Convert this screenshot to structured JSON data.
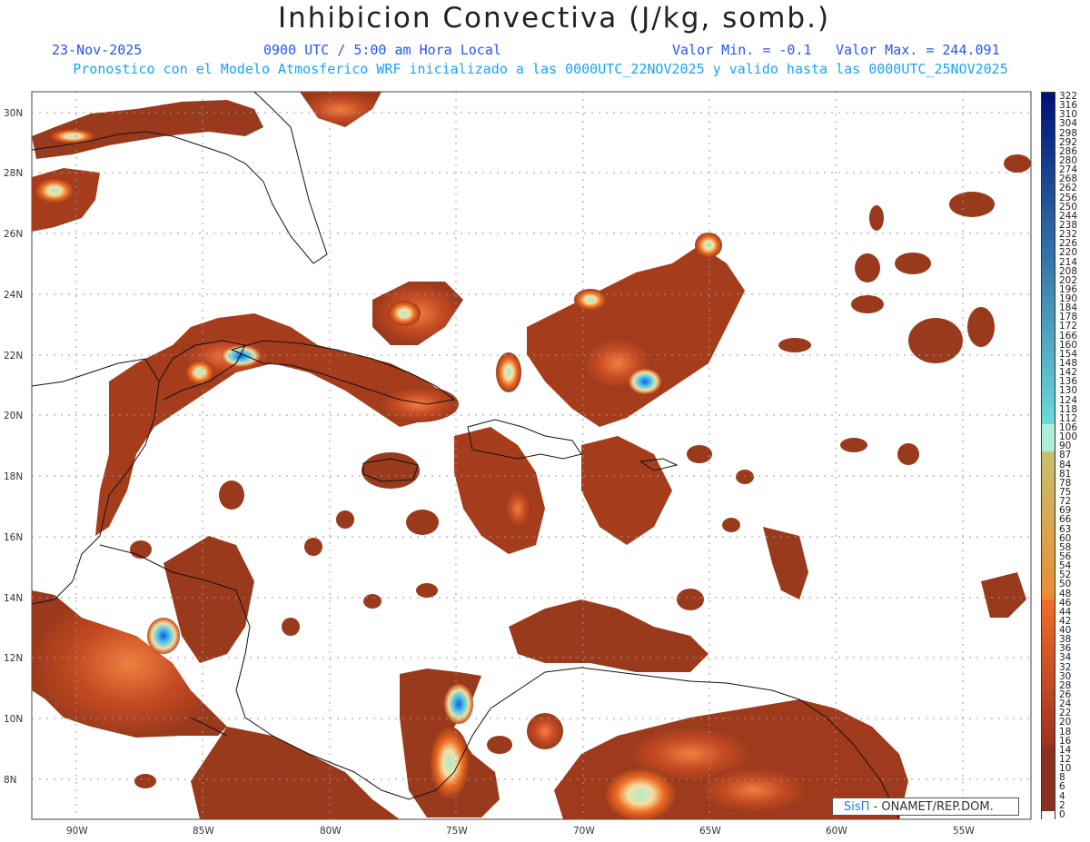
{
  "header": {
    "title": "Inhibicion Convectiva (J/kg, somb.)",
    "date": "23-Nov-2025",
    "time": "0900 UTC / 5:00 am Hora Local",
    "valmin": "Valor Min. = -0.1",
    "valmax": "Valor Max. = 244.091",
    "subtitle": "Pronostico con el Modelo Atmosferico WRF inicializado a las 0000UTC_22NOV2025 y valido hasta las  0000UTC_25NOV2025"
  },
  "map": {
    "lat_labels": [
      "30N",
      "28N",
      "26N",
      "24N",
      "22N",
      "20N",
      "18N",
      "16N",
      "14N",
      "12N",
      "10N",
      "8N"
    ],
    "lon_labels": [
      "90W",
      "85W",
      "80W",
      "75W",
      "70W",
      "65W",
      "60W",
      "55W"
    ]
  },
  "colorbar": {
    "labels": [
      "322",
      "316",
      "310",
      "304",
      "298",
      "292",
      "286",
      "280",
      "274",
      "268",
      "262",
      "256",
      "250",
      "244",
      "238",
      "232",
      "226",
      "220",
      "214",
      "208",
      "202",
      "196",
      "190",
      "184",
      "178",
      "172",
      "166",
      "160",
      "154",
      "148",
      "142",
      "136",
      "130",
      "124",
      "118",
      "112",
      "106",
      "100",
      "90",
      "87",
      "84",
      "81",
      "78",
      "75",
      "72",
      "69",
      "66",
      "63",
      "60",
      "58",
      "56",
      "54",
      "52",
      "50",
      "48",
      "46",
      "44",
      "42",
      "40",
      "38",
      "36",
      "34",
      "32",
      "30",
      "28",
      "26",
      "24",
      "22",
      "20",
      "18",
      "16",
      "14",
      "12",
      "10",
      "8",
      "6",
      "4",
      "2",
      "0"
    ]
  },
  "credit": {
    "brand": "SisΠ",
    "org": " - ONAMET/REP.DOM."
  }
}
